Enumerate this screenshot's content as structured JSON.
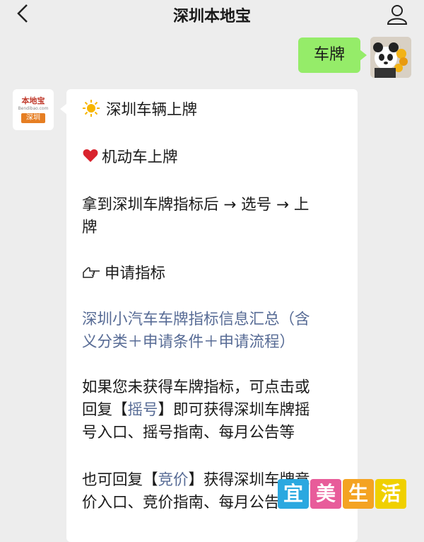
{
  "header": {
    "title": "深圳本地宝",
    "back_icon": "chevron-left-icon",
    "profile_icon": "person-icon"
  },
  "user_message": {
    "text": "车牌"
  },
  "bot_avatar": {
    "name": "本地宝",
    "domain": "Bendibao.com",
    "city": "深圳"
  },
  "reply": {
    "line1": "深圳车辆上牌",
    "line2": "机动车上牌",
    "line3a": "拿到深圳车牌指标后 → 选号 → 上",
    "line3b": "牌",
    "line4": "申请指标",
    "link_a": "深圳小汽车车牌指标信息汇总（含",
    "link_b": "义分类＋申请条件＋申请流程）",
    "p1a": "如果您未获得车牌指标，可点击或",
    "p1b_pre": "回复【",
    "p1b_link": "摇号",
    "p1b_post": "】即可获得深圳车牌摇",
    "p1c": "号入口、摇号指南、每月公告等",
    "p2a_pre": "也可回复【",
    "p2a_link": "竞价",
    "p2a_post": "】获得深圳车牌竞",
    "p2b": "价入口、竞价指南、每月公告等"
  },
  "watermark": {
    "chars": [
      "宜",
      "美",
      "生",
      "活"
    ],
    "colors": [
      "#2ba8e0",
      "#e85c9a",
      "#f4a322",
      "#f0d000"
    ]
  },
  "colors": {
    "bubble_out": "#95ec69",
    "link": "#576b95",
    "background": "#ededed"
  }
}
